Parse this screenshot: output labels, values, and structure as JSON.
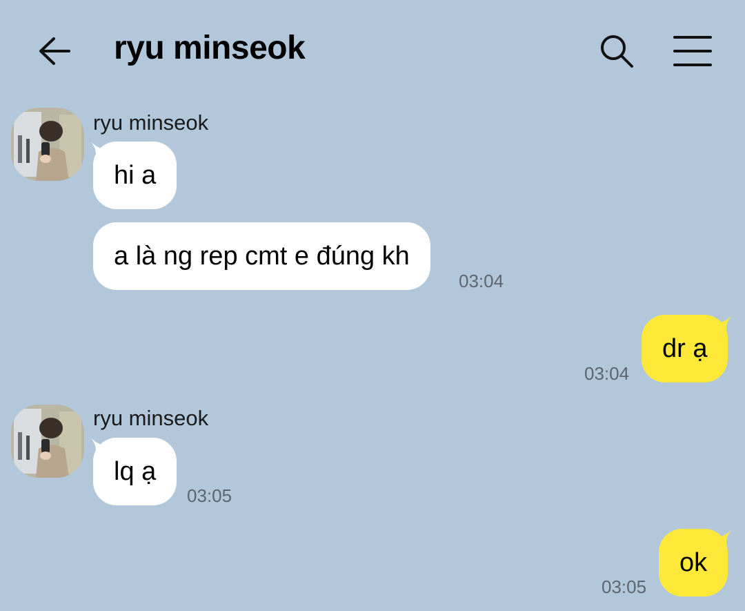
{
  "header": {
    "title": "ryu minseok",
    "icons": {
      "back": "arrow-left-icon",
      "search": "search-icon",
      "menu": "hamburger-menu-icon"
    }
  },
  "colors": {
    "background": "#b2c7da",
    "incoming_bubble": "#ffffff",
    "outgoing_bubble": "#fee93b",
    "timestamp": "#5d6670"
  },
  "messages": [
    {
      "group": "incoming",
      "sender": "ryu minseok",
      "bubbles": [
        {
          "text": "hi a",
          "time": ""
        },
        {
          "text": "a là ng rep cmt e đúng kh",
          "time": "03:04"
        }
      ]
    },
    {
      "group": "outgoing",
      "bubbles": [
        {
          "text": "dr ạ",
          "time": "03:04"
        }
      ]
    },
    {
      "group": "incoming",
      "sender": "ryu minseok",
      "bubbles": [
        {
          "text": "lq ạ",
          "time": "03:05"
        }
      ]
    },
    {
      "group": "outgoing",
      "bubbles": [
        {
          "text": "ok",
          "time": "03:05"
        }
      ]
    }
  ]
}
